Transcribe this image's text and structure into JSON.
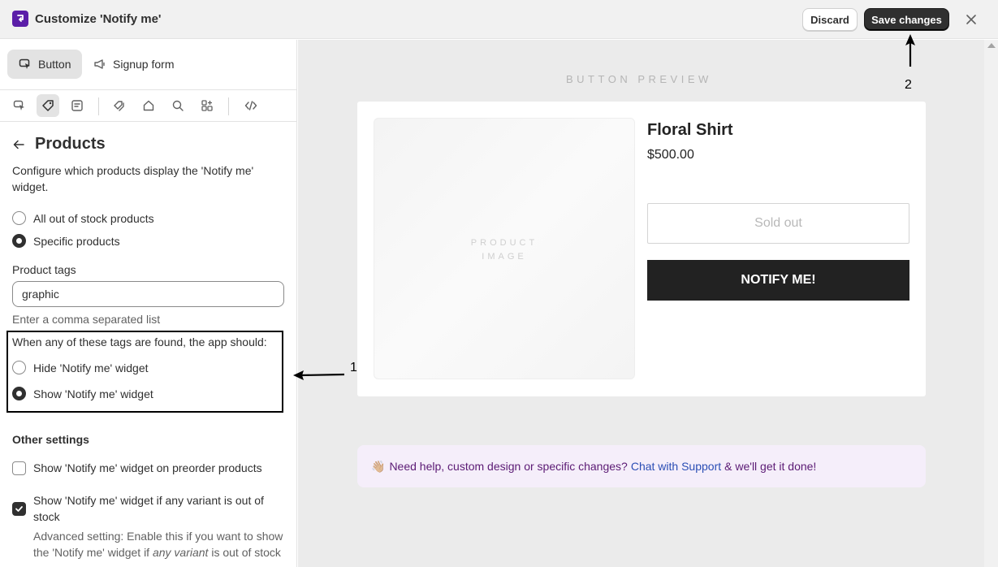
{
  "header": {
    "title": "Customize 'Notify me'",
    "discard_label": "Discard",
    "save_label": "Save changes"
  },
  "tabs": [
    {
      "label": "Button",
      "active": true
    },
    {
      "label": "Signup form",
      "active": false
    }
  ],
  "icon_bar": [
    "cursor-icon",
    "tag-icon",
    "form-icon",
    "tags-icon",
    "home-icon",
    "search-icon",
    "apps-icon",
    "code-icon"
  ],
  "panel": {
    "title": "Products",
    "description": "Configure which products display the 'Notify me' widget.",
    "scope_options": [
      {
        "label": "All out of stock products",
        "checked": false
      },
      {
        "label": "Specific products",
        "checked": true
      }
    ],
    "tags_label": "Product tags",
    "tags_value": "graphic",
    "tags_help": "Enter a comma separated list",
    "action_label": "When any of these tags are found, the app should:",
    "action_options": [
      {
        "label": "Hide 'Notify me' widget",
        "checked": false
      },
      {
        "label": "Show 'Notify me' widget",
        "checked": true
      }
    ],
    "other_settings_title": "Other settings",
    "other_settings": [
      {
        "label": "Show 'Notify me' widget on preorder products",
        "checked": false
      },
      {
        "label": "Show 'Notify me' widget if any variant is out of stock",
        "checked": true
      }
    ],
    "advanced_prefix": "Advanced setting: Enable this if you want to show the 'Notify me' widget if ",
    "advanced_em": "any variant",
    "advanced_suffix": " is out of stock"
  },
  "preview": {
    "label": "BUTTON PREVIEW",
    "image_placeholder_line1": "PRODUCT",
    "image_placeholder_line2": "IMAGE",
    "product_name": "Floral Shirt",
    "price": "$500.00",
    "soldout_label": "Sold out",
    "notify_label": "NOTIFY ME!"
  },
  "help_banner": {
    "emoji": "👋🏼",
    "text": "Need help, custom design or specific changes?",
    "link": "Chat with Support",
    "suffix": "& we'll get it done!"
  },
  "annotations": {
    "marker_1": "1",
    "marker_2": "2"
  },
  "colors": {
    "brand": "#5b1ea8",
    "primary_button": "#303030",
    "notify_button": "#222222",
    "link": "#2b4eb5"
  }
}
